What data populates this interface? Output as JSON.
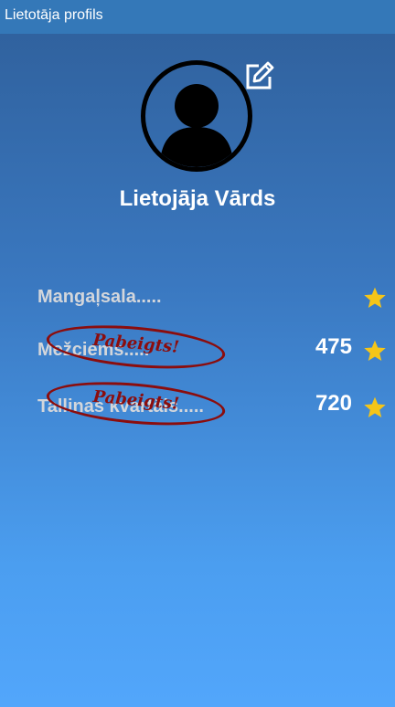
{
  "window": {
    "title": "Lietotāja profils"
  },
  "profile": {
    "name": "Lietojāja Vārds",
    "edit_icon": "edit-icon",
    "avatar_icon": "person-icon"
  },
  "routes": [
    {
      "name": "Mangaļsala.....",
      "score": "",
      "completed": false
    },
    {
      "name": "Mežciems.....",
      "score": "475",
      "completed": true,
      "stamp": "Pabeigts!"
    },
    {
      "name": "Tallinas kvartāls.....",
      "score": "720",
      "completed": true,
      "stamp": "Pabeigts!"
    }
  ],
  "colors": {
    "star": "#f5c518",
    "stamp": "#8b0d0d",
    "titlebar": "#3478b8"
  }
}
